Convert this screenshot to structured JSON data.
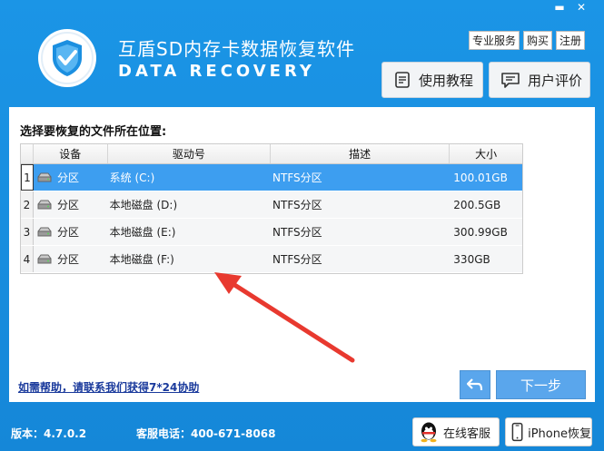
{
  "window": {
    "minimize_label": "▬",
    "close_label": "✕"
  },
  "header": {
    "title": "互盾SD内存卡数据恢复软件",
    "subtitle": "DATA RECOVERY",
    "links": [
      "专业服务",
      "购买",
      "注册"
    ],
    "tutorial_label": "使用教程",
    "review_label": "用户评价"
  },
  "main": {
    "prompt": "选择要恢复的文件所在位置:",
    "columns": [
      "设备",
      "驱动号",
      "描述",
      "大小"
    ],
    "rows": [
      {
        "index": "1",
        "device": "分区",
        "drive": "系统 (C:)",
        "desc": "NTFS分区",
        "size": "100.01GB",
        "selected": true
      },
      {
        "index": "2",
        "device": "分区",
        "drive": "本地磁盘 (D:)",
        "desc": "NTFS分区",
        "size": "200.5GB"
      },
      {
        "index": "3",
        "device": "分区",
        "drive": "本地磁盘 (E:)",
        "desc": "NTFS分区",
        "size": "300.99GB"
      },
      {
        "index": "4",
        "device": "分区",
        "drive": "本地磁盘 (F:)",
        "desc": "NTFS分区",
        "size": "330GB"
      }
    ],
    "help_link": "如需帮助，请联系我们获得7*24协助",
    "next_label": "下一步"
  },
  "footer": {
    "version": "版本：4.7.0.2",
    "hotline": "客服电话：400-671-8068",
    "online_service": "在线客服",
    "iphone_recovery": "iPhone恢复"
  },
  "colors": {
    "accent": "#1b8fe0",
    "selected_row": "#3d9ef0",
    "arrow": "#e8392f"
  }
}
